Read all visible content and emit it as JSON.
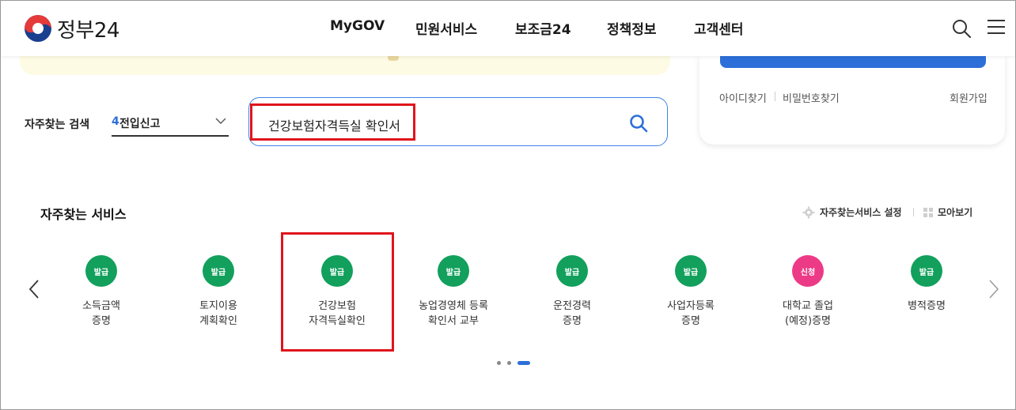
{
  "header": {
    "logo_text": "정부24",
    "nav": [
      "MyGOV",
      "민원서비스",
      "보조금24",
      "정책정보",
      "고객센터"
    ]
  },
  "login": {
    "find_id": "아이디찾기",
    "find_pw": "비밀번호찾기",
    "signup": "회원가입"
  },
  "frequent_search": {
    "label": "자주찾는 검색",
    "select_rank": "4",
    "select_text": "전입신고",
    "query": "건강보험자격득실 확인서"
  },
  "services": {
    "title": "자주찾는 서비스",
    "settings_label": "자주찾는서비스 설정",
    "collect_label": "모아보기",
    "items": [
      {
        "badge": "발급",
        "badge_color": "#12a05c",
        "line1": "소득금액",
        "line2": "증명"
      },
      {
        "badge": "발급",
        "badge_color": "#12a05c",
        "line1": "토지이용",
        "line2": "계획확인"
      },
      {
        "badge": "발급",
        "badge_color": "#12a05c",
        "line1": "건강보험",
        "line2": "자격득실확인"
      },
      {
        "badge": "발급",
        "badge_color": "#12a05c",
        "line1": "농업경영체 등록",
        "line2": "확인서 교부"
      },
      {
        "badge": "발급",
        "badge_color": "#12a05c",
        "line1": "운전경력",
        "line2": "증명"
      },
      {
        "badge": "발급",
        "badge_color": "#12a05c",
        "line1": "사업자등록",
        "line2": "증명"
      },
      {
        "badge": "신청",
        "badge_color": "#ec3a86",
        "line1": "대학교 졸업",
        "line2": "(예정)증명"
      },
      {
        "badge": "발급",
        "badge_color": "#12a05c",
        "line1": "병적증명",
        "line2": ""
      }
    ],
    "pager": {
      "total": 3,
      "active": 3
    }
  },
  "colors": {
    "accent": "#2d6fd9",
    "highlight": "#e0141c",
    "issue_badge": "#12a05c",
    "apply_badge": "#ec3a86"
  }
}
